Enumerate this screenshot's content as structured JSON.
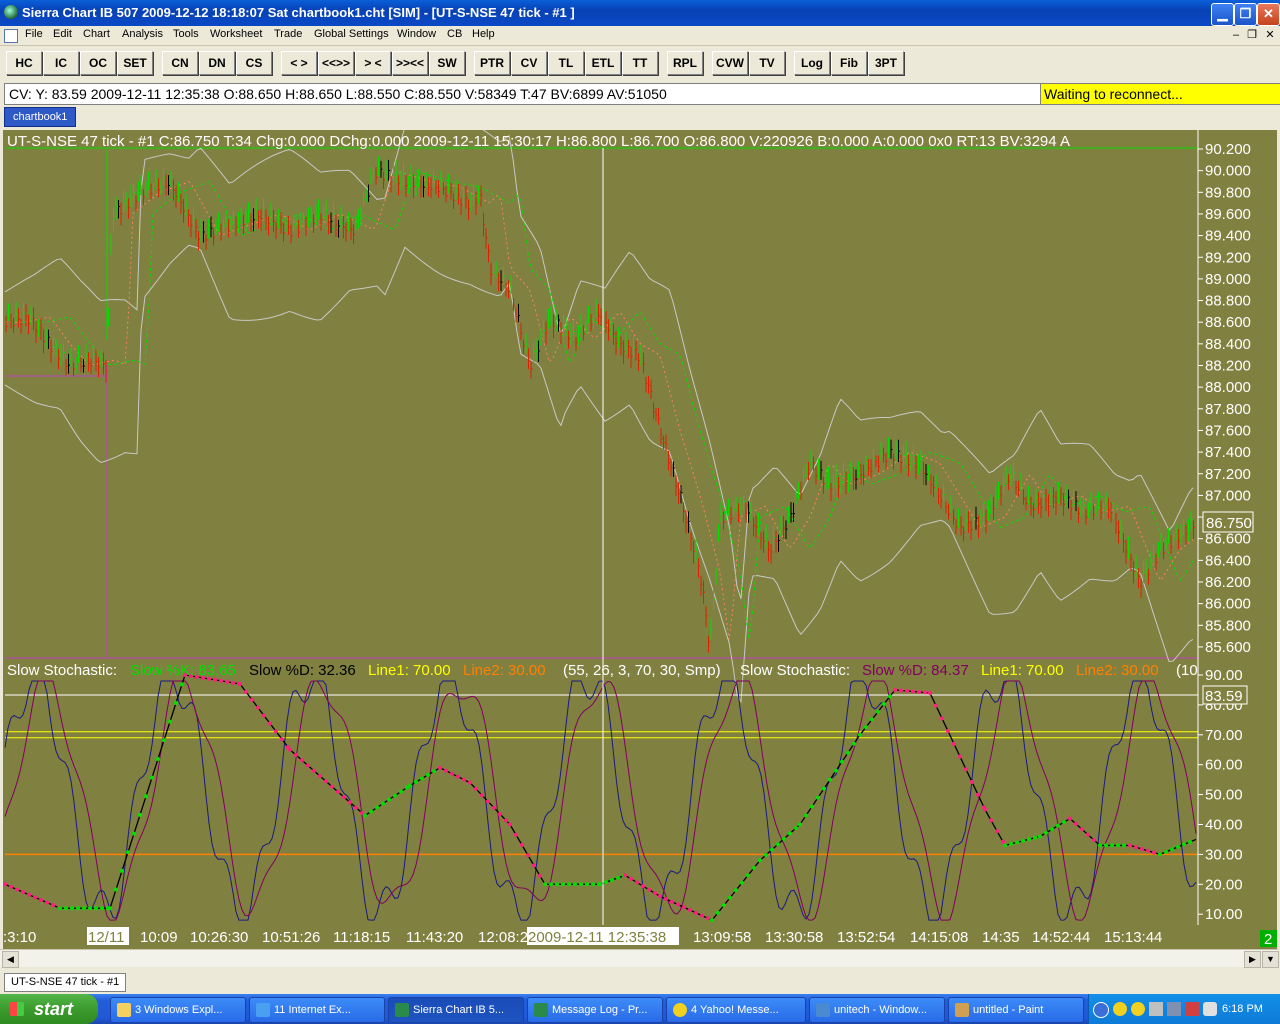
{
  "window": {
    "title": "Sierra Chart IB 507   2009-12-12  18:18:07  Sat   chartbook1.cht [SIM] - [UT-S-NSE  47 tick - #1 ]",
    "minimize": "▁",
    "maximize": "❐",
    "close": "✕"
  },
  "menu": [
    "File",
    "Edit",
    "Chart",
    "Analysis",
    "Tools",
    "Worksheet",
    "Trade",
    "Global Settings",
    "Window",
    "CB",
    "Help"
  ],
  "mdi_buttons": [
    "–",
    "❐",
    "✕"
  ],
  "toolbar": [
    "HC",
    "IC",
    "OC",
    "SET",
    "CN",
    "DN",
    "CS",
    "< >",
    "<<>>",
    "> <",
    ">><<",
    "SW",
    "PTR",
    "CV",
    "TL",
    "ETL",
    "TT",
    "RPL",
    "CVW",
    "TV",
    "Log",
    "Fib",
    "3PT"
  ],
  "cv_line": "CV: Y: 83.59  2009-12-11  12:35:38  O:88.650  H:88.650  L:88.550  C:88.550  V:58349  T:47  BV:6899  AV:51050",
  "reconnect": "Waiting to reconnect...",
  "chartbook_tab": "chartbook1",
  "chart_header": "UT-S-NSE  47 tick - #1  C:86.750  T:34  Chg:0.000  DChg:0.000  2009-12-11  15:30:17  H:86.800  L:86.700  O:86.800  V:220926  B:0.000  A:0.000  0x0  RT:13  BV:3294  A",
  "stoch_header": {
    "p1": "Slow Stochastic:",
    "k": "Slow %K: 83.65",
    "d": "Slow %D: 32.36",
    "l1": "Line1: 70.00",
    "l2": "Line2: 30.00",
    "params": "(55, 26, 3, 70, 30, Smp)",
    "p2": "Slow Stochastic:",
    "d2": "Slow %D: 84.37",
    "l1b": "Line1: 70.00",
    "l2b": "Line2: 30.00",
    "tail": "(10"
  },
  "price_axis": [
    "90.200",
    "90.000",
    "89.800",
    "89.600",
    "89.400",
    "89.200",
    "89.000",
    "88.800",
    "88.600",
    "88.400",
    "88.200",
    "88.000",
    "87.800",
    "87.600",
    "87.400",
    "87.200",
    "87.000",
    "86.800",
    "86.600",
    "86.400",
    "86.200",
    "86.000",
    "85.800",
    "85.600"
  ],
  "current_price": "86.750",
  "stoch_axis": [
    "90.00",
    "80.00",
    "70.00",
    "60.00",
    "50.00",
    "40.00",
    "30.00",
    "20.00",
    "10.00"
  ],
  "stoch_current": "83.59",
  "time_axis": [
    ":3:10",
    "12/11",
    "10:09",
    "10:26:30",
    "10:51:26",
    "11:18:15",
    "11:43:20",
    "12:08:2",
    "2009-12-11  12:35:38",
    "13:09:58",
    "13:30:58",
    "13:52:54",
    "14:15:08",
    "14:35",
    "14:52:44",
    "15:13:44"
  ],
  "side_marker": "2",
  "bottom_tab": "UT-S-NSE  47 tick - #1",
  "taskbar": {
    "start": "start",
    "tasks": [
      "3 Windows Expl...",
      "11 Internet Ex...",
      "Sierra Chart IB 5...",
      "Message Log - Pr...",
      "4 Yahoo! Messe...",
      "unitech - Window...",
      "untitled - Paint"
    ],
    "clock": "6:18 PM"
  },
  "colors": {
    "chart_bg": "#808040",
    "up": "#00e000",
    "down": "#e02000",
    "neutral": "#000000",
    "bands": "#c8c8c8",
    "stoch_k": "#1a1a80",
    "stoch_d": "#800060",
    "line1": "#ffff00",
    "line2": "#ff8000"
  }
}
